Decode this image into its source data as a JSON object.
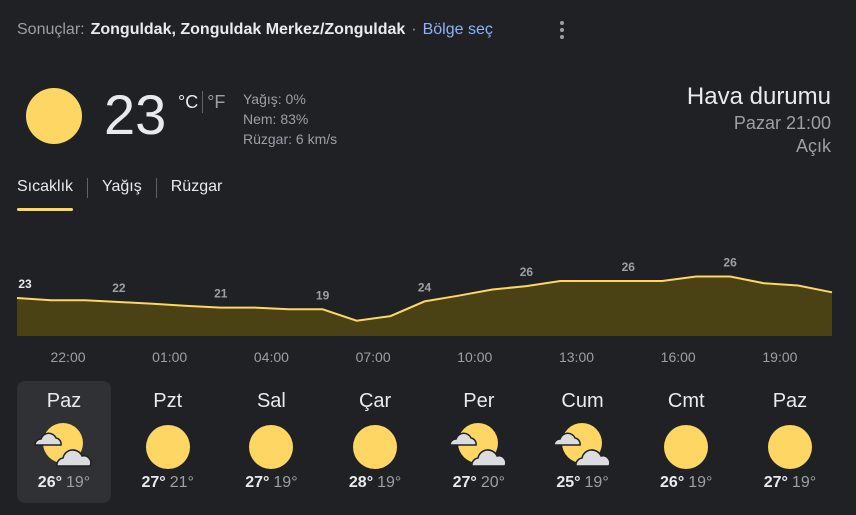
{
  "header": {
    "prefix": "Sonuçlar:",
    "location": "Zonguldak, Zonguldak Merkez/Zonguldak",
    "separator": "·",
    "region_link": "Bölge seç",
    "more_icon": "more-vert-icon"
  },
  "current": {
    "icon": "sunny-icon",
    "temperature": "23",
    "unit_c": "°C",
    "unit_f": "°F",
    "precipitation": "Yağış: 0%",
    "humidity": "Nem: 83%",
    "wind": "Rüzgar: 6 km/s",
    "title": "Hava durumu",
    "datetime": "Pazar 21:00",
    "condition": "Açık"
  },
  "tabs": [
    {
      "label": "Sıcaklık",
      "active": true
    },
    {
      "label": "Yağış",
      "active": false
    },
    {
      "label": "Rüzgar",
      "active": false
    }
  ],
  "chart_data": {
    "type": "area",
    "x": [
      "21:00",
      "22:00",
      "23:00",
      "00:00",
      "01:00",
      "02:00",
      "03:00",
      "04:00",
      "05:00",
      "06:00",
      "07:00",
      "08:00",
      "09:00",
      "10:00",
      "11:00",
      "12:00",
      "13:00",
      "14:00",
      "15:00",
      "16:00",
      "17:00",
      "18:00",
      "19:00",
      "20:00",
      "21:00"
    ],
    "values": [
      23,
      22.6,
      22.6,
      22.3,
      22,
      21.6,
      21.3,
      21.3,
      21,
      21,
      19,
      19.8,
      22.4,
      23.4,
      24.5,
      25.1,
      26,
      26,
      26,
      26,
      26.8,
      26.8,
      25.6,
      25.2,
      24
    ],
    "labels": [
      {
        "index": 0,
        "text": "23"
      },
      {
        "index": 3,
        "text": "22"
      },
      {
        "index": 6,
        "text": "21"
      },
      {
        "index": 9,
        "text": "19"
      },
      {
        "index": 12,
        "text": "24"
      },
      {
        "index": 15,
        "text": "26"
      },
      {
        "index": 18,
        "text": "26"
      },
      {
        "index": 21,
        "text": "26"
      }
    ],
    "ticks": [
      "22:00",
      "01:00",
      "04:00",
      "07:00",
      "10:00",
      "13:00",
      "16:00",
      "19:00"
    ],
    "line_color": "#fdd663",
    "fill_color": "#4a4115"
  },
  "days": [
    {
      "name": "Paz",
      "icon": "partly-sunny-icon",
      "high": "26°",
      "low": "19°",
      "selected": true
    },
    {
      "name": "Pzt",
      "icon": "sunny-icon",
      "high": "27°",
      "low": "21°",
      "selected": false
    },
    {
      "name": "Sal",
      "icon": "sunny-icon",
      "high": "27°",
      "low": "19°",
      "selected": false
    },
    {
      "name": "Çar",
      "icon": "sunny-icon",
      "high": "28°",
      "low": "19°",
      "selected": false
    },
    {
      "name": "Per",
      "icon": "partly-sunny-icon",
      "high": "27°",
      "low": "20°",
      "selected": false
    },
    {
      "name": "Cum",
      "icon": "partly-sunny-icon",
      "high": "25°",
      "low": "19°",
      "selected": false
    },
    {
      "name": "Cmt",
      "icon": "sunny-icon",
      "high": "26°",
      "low": "19°",
      "selected": false
    },
    {
      "name": "Paz",
      "icon": "sunny-icon",
      "high": "27°",
      "low": "19°",
      "selected": false
    }
  ]
}
